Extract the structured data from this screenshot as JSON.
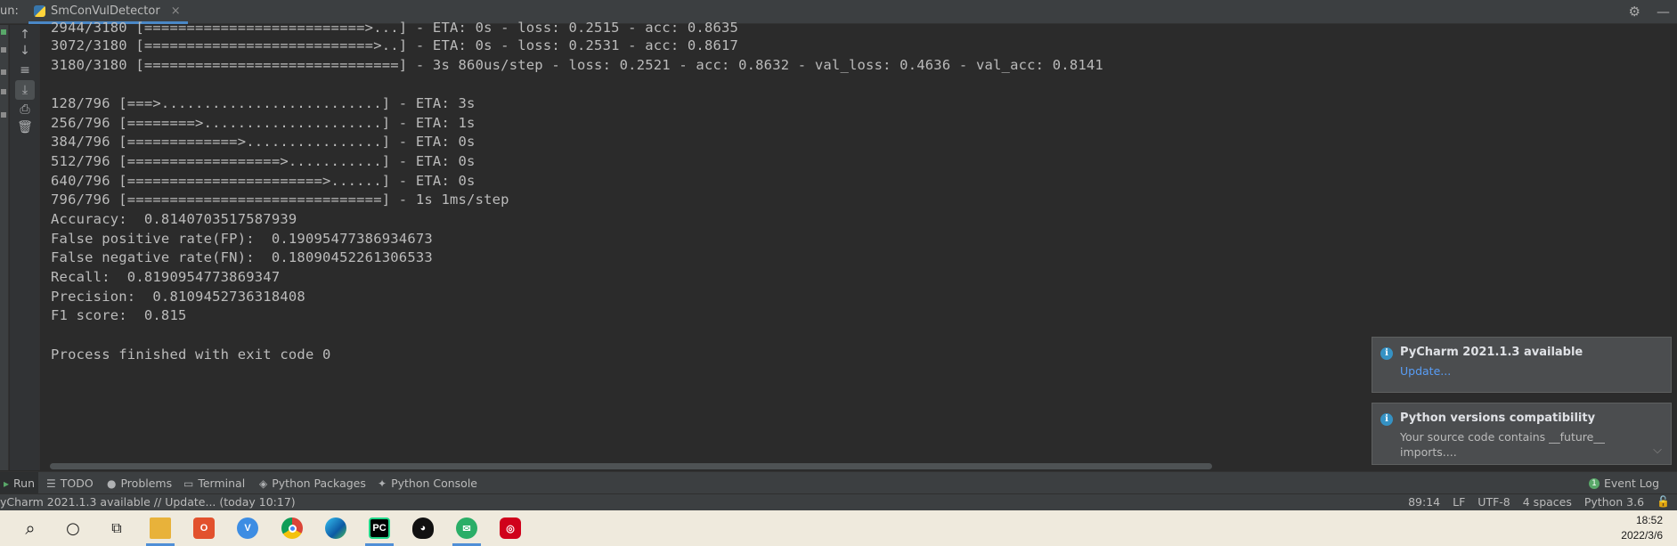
{
  "run_window": {
    "label": "un:",
    "tab_label": "SmConVulDetector",
    "tab_close": "×",
    "settings_icon": "gear-icon",
    "minimize_icon": "minimize-icon"
  },
  "console": {
    "lines": [
      "2944/3180 [==========================>...] - ETA: 0s - loss: 0.2515 - acc: 0.8635",
      "3072/3180 [===========================>..] - ETA: 0s - loss: 0.2531 - acc: 0.8617",
      "3180/3180 [==============================] - 3s 860us/step - loss: 0.2521 - acc: 0.8632 - val_loss: 0.4636 - val_acc: 0.8141",
      "",
      "128/796 [===>..........................] - ETA: 3s",
      "256/796 [========>.....................] - ETA: 1s",
      "384/796 [=============>................] - ETA: 0s",
      "512/796 [==================>...........] - ETA: 0s",
      "640/796 [=======================>......] - ETA: 0s",
      "796/796 [==============================] - 1s 1ms/step",
      "Accuracy:  0.8140703517587939",
      "False positive rate(FP):  0.19095477386934673",
      "False negative rate(FN):  0.18090452261306533",
      "Recall:  0.8190954773869347",
      "Precision:  0.8109452736318408",
      "F1 score:  0.815",
      "",
      "Process finished with exit code 0"
    ]
  },
  "notifications": [
    {
      "title": "PyCharm 2021.1.3 available",
      "link": "Update..."
    },
    {
      "title": "Python versions compatibility",
      "body": "Your source code contains __future__ imports...."
    }
  ],
  "tool_windows": {
    "run": "Run",
    "todo": "TODO",
    "problems": "Problems",
    "terminal": "Terminal",
    "python_packages": "Python Packages",
    "python_console": "Python Console",
    "event_log": "Event Log",
    "event_log_count": "1"
  },
  "status_bar": {
    "message": "yCharm 2021.1.3 available // Update... (today 10:17)",
    "position": "89:14",
    "line_separator": "LF",
    "encoding": "UTF-8",
    "indent": "4 spaces",
    "interpreter": "Python 3.6"
  },
  "taskbar": {
    "time": "18:52",
    "date": "2022/3/6",
    "pycharm_label": "PC"
  }
}
